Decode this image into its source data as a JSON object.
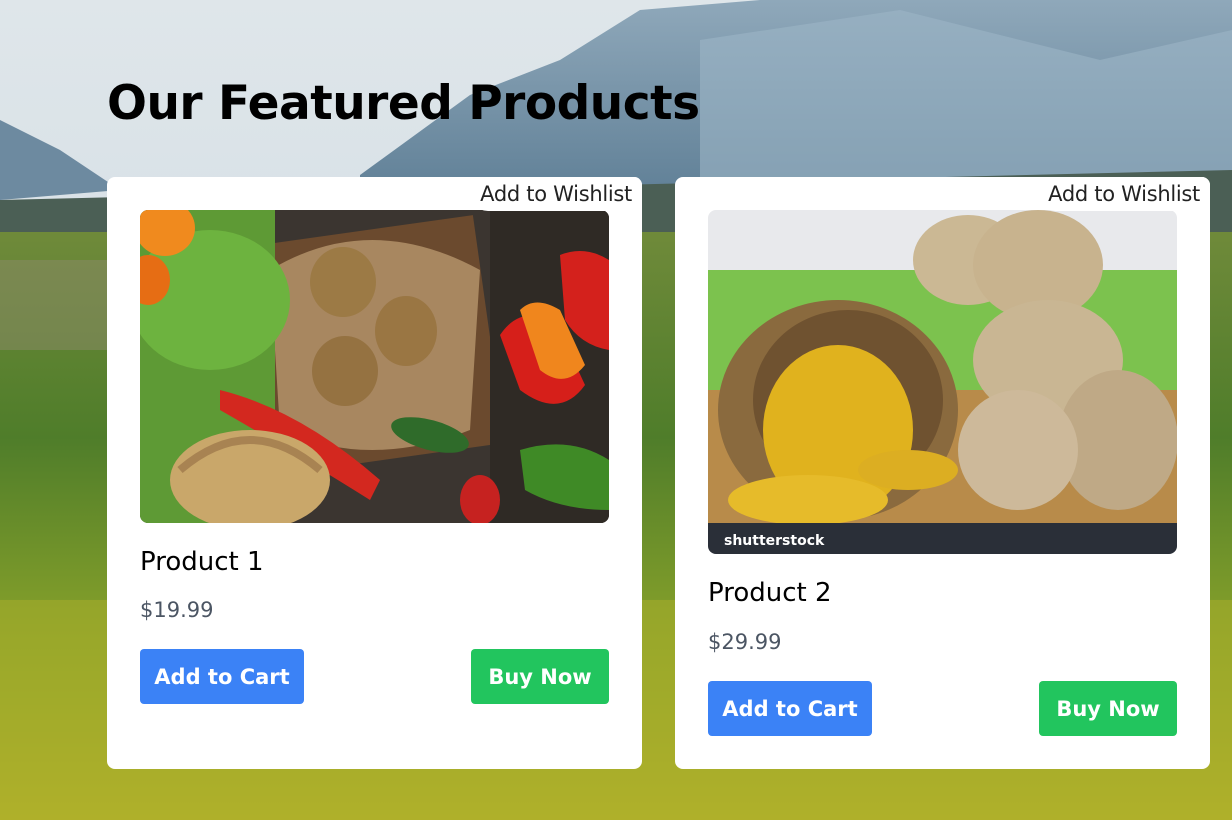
{
  "page": {
    "heading": "Our Featured Products"
  },
  "products": [
    {
      "name": "Product 1",
      "price": "$19.99",
      "wishlist_label": "Add to Wishlist",
      "add_to_cart_label": "Add to Cart",
      "buy_now_label": "Buy Now"
    },
    {
      "name": "Product 2",
      "price": "$29.99",
      "wishlist_label": "Add to Wishlist",
      "add_to_cart_label": "Add to Cart",
      "buy_now_label": "Buy Now",
      "image_watermark": "shutterstock"
    }
  ],
  "colors": {
    "add_to_cart": "#3b82f6",
    "buy_now": "#22c55e",
    "price_text": "#4b5563"
  }
}
